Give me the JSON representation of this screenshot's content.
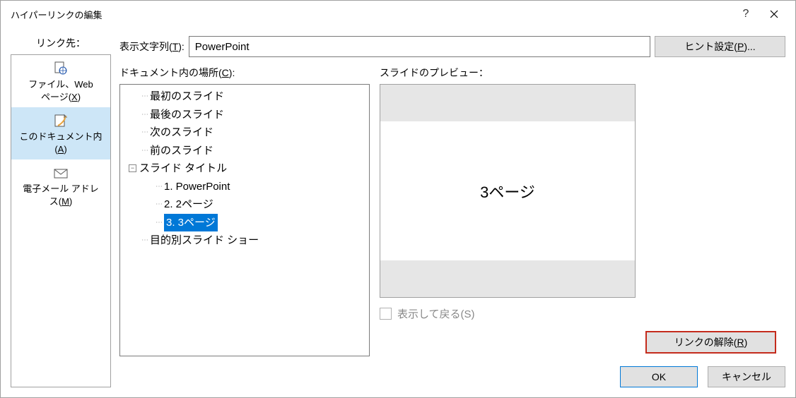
{
  "dialog": {
    "title": "ハイパーリンクの編集"
  },
  "left": {
    "link_to_label": "リンク先：",
    "items": [
      {
        "label_pre": "ファイル、Web\nページ(",
        "accel": "X",
        "label_post": ")",
        "icon": "file-web"
      },
      {
        "label_pre": "このドキュメント内\n(",
        "accel": "A",
        "label_post": ")",
        "icon": "doc-place"
      },
      {
        "label_pre": "電子メール アドレ\nス(",
        "accel": "M",
        "label_post": ")",
        "icon": "email"
      }
    ],
    "selected_index": 1
  },
  "display": {
    "label_pre": "表示文字列(",
    "accel": "T",
    "label_post": "):",
    "value": "PowerPoint",
    "hint_button_pre": "ヒント設定(",
    "hint_accel": "P",
    "hint_button_post": ")..."
  },
  "location": {
    "label_pre": "ドキュメント内の場所(",
    "accel": "C",
    "label_post": "):",
    "items": [
      {
        "label": "最初のスライド",
        "level": 1
      },
      {
        "label": "最後のスライド",
        "level": 1
      },
      {
        "label": "次のスライド",
        "level": 1
      },
      {
        "label": "前のスライド",
        "level": 1
      },
      {
        "label": "スライド タイトル",
        "level": 1,
        "expandable": true
      },
      {
        "label": "1. PowerPoint",
        "level": 2
      },
      {
        "label": "2. 2ページ",
        "level": 2
      },
      {
        "label": "3. 3ページ",
        "level": 2,
        "selected": true
      },
      {
        "label": "目的別スライド ショー",
        "level": 1
      }
    ]
  },
  "preview": {
    "label": "スライドのプレビュー：",
    "slide_text": "3ページ",
    "show_return_label": "表示して戻る(S)"
  },
  "actions": {
    "remove_pre": "リンクの解除(",
    "remove_accel": "R",
    "remove_post": ")"
  },
  "footer": {
    "ok": "OK",
    "cancel": "キャンセル"
  }
}
